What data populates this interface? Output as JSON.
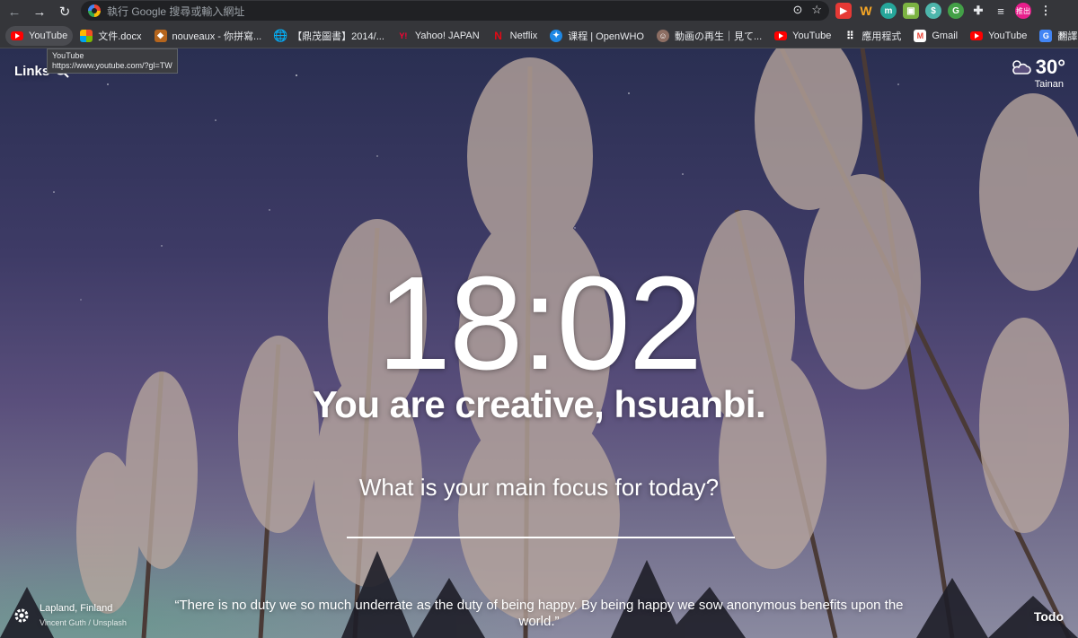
{
  "browser": {
    "omnibox_placeholder": "執行 Google 搜尋或輸入網址",
    "avatar_label": "推出"
  },
  "bookmarks": [
    {
      "label": "YouTube",
      "icon": "youtube-icon"
    },
    {
      "label": "文件.docx",
      "icon": "microsoft-icon"
    },
    {
      "label": "nouveaux - 你拼寫...",
      "icon": "crest-icon"
    },
    {
      "label": "【鼎茂圖書】2014/...",
      "icon": "globe-icon"
    },
    {
      "label": "Yahoo! JAPAN",
      "icon": "yahoo-icon"
    },
    {
      "label": "Netflix",
      "icon": "netflix-icon"
    },
    {
      "label": "课程 | OpenWHO",
      "icon": "who-icon"
    },
    {
      "label": "動画の再生｜見て...",
      "icon": "character-icon"
    },
    {
      "label": "YouTube",
      "icon": "youtube-icon"
    },
    {
      "label": "應用程式",
      "icon": "apps-grid-icon"
    },
    {
      "label": "Gmail",
      "icon": "gmail-icon"
    },
    {
      "label": "YouTube",
      "icon": "youtube-icon"
    },
    {
      "label": "翻譯",
      "icon": "translate-icon"
    }
  ],
  "tooltip": {
    "title": "YouTube",
    "url": "https://www.youtube.com/?gl=TW"
  },
  "dashboard": {
    "links_label": "Links",
    "weather": {
      "temp": "30°",
      "city": "Tainan",
      "icon": "partly-cloudy-icon"
    },
    "time": "18:02",
    "greeting": "You are creative, hsuanbi.",
    "focus_question": "What is your main focus for today?",
    "focus_value": "",
    "photo_location": "Lapland, Finland",
    "photo_credit": "Vincent Guth / Unsplash",
    "quote": "“There is no duty we so much underrate as the duty of being happy. By being happy we sow anonymous benefits upon the world.”",
    "todo_label": "Todo"
  },
  "colors": {
    "chrome_bg": "#35363a",
    "omnibox_bg": "#202124",
    "youtube_red": "#ff0000"
  }
}
